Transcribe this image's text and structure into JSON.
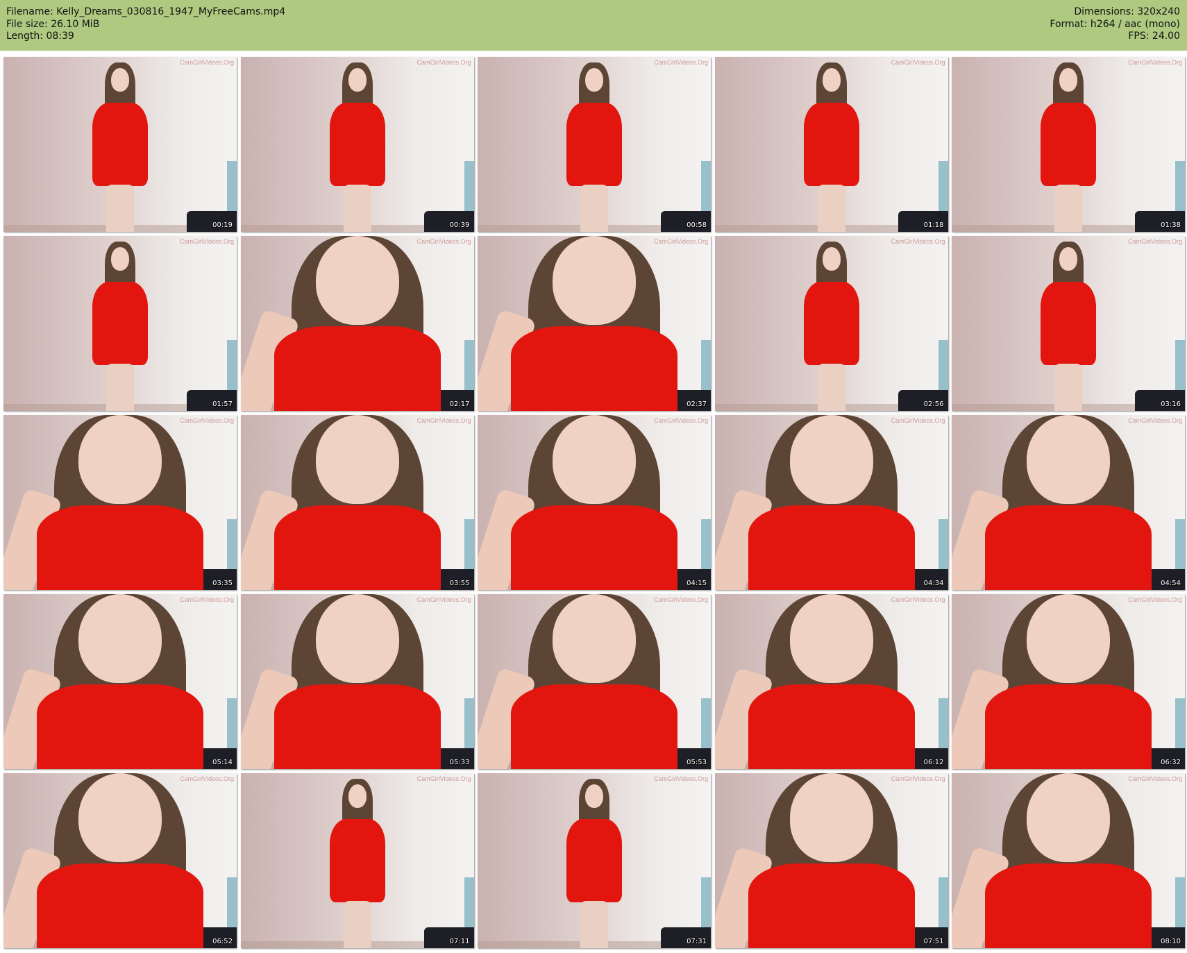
{
  "header": {
    "filename": "Filename: Kelly_Dreams_030816_1947_MyFreeCams.mp4",
    "filesize": "File size: 26.10 MiB",
    "length": "Length: 08:39",
    "dimensions": "Dimensions: 320x240",
    "format": "Format: h264 / aac (mono)",
    "fps": "FPS: 24.00"
  },
  "thumbnails": [
    {
      "time": "00:19",
      "watermark": "CamGirlVideos.Org",
      "shot": "full"
    },
    {
      "time": "00:39",
      "watermark": "CamGirlVideos.Org",
      "shot": "full"
    },
    {
      "time": "00:58",
      "watermark": "CamGirlVideos.Org",
      "shot": "full"
    },
    {
      "time": "01:18",
      "watermark": "CamGirlVideos.Org",
      "shot": "full"
    },
    {
      "time": "01:38",
      "watermark": "CamGirlVideos.Org",
      "shot": "full"
    },
    {
      "time": "01:57",
      "watermark": "CamGirlVideos.Org",
      "shot": "full"
    },
    {
      "time": "02:17",
      "watermark": "CamGirlVideos.Org",
      "shot": "close"
    },
    {
      "time": "02:37",
      "watermark": "CamGirlVideos.Org",
      "shot": "close"
    },
    {
      "time": "02:56",
      "watermark": "CamGirlVideos.Org",
      "shot": "full"
    },
    {
      "time": "03:16",
      "watermark": "CamGirlVideos.Org",
      "shot": "full"
    },
    {
      "time": "03:35",
      "watermark": "CamGirlVideos.Org",
      "shot": "close"
    },
    {
      "time": "03:55",
      "watermark": "CamGirlVideos.Org",
      "shot": "close"
    },
    {
      "time": "04:15",
      "watermark": "CamGirlVideos.Org",
      "shot": "close"
    },
    {
      "time": "04:34",
      "watermark": "CamGirlVideos.Org",
      "shot": "close"
    },
    {
      "time": "04:54",
      "watermark": "CamGirlVideos.Org",
      "shot": "close"
    },
    {
      "time": "05:14",
      "watermark": "CamGirlVideos.Org",
      "shot": "close"
    },
    {
      "time": "05:33",
      "watermark": "CamGirlVideos.Org",
      "shot": "close"
    },
    {
      "time": "05:53",
      "watermark": "CamGirlVideos.Org",
      "shot": "close"
    },
    {
      "time": "06:12",
      "watermark": "CamGirlVideos.Org",
      "shot": "close"
    },
    {
      "time": "06:32",
      "watermark": "CamGirlVideos.Org",
      "shot": "close"
    },
    {
      "time": "06:52",
      "watermark": "CamGirlVideos.Org",
      "shot": "close"
    },
    {
      "time": "07:11",
      "watermark": "CamGirlVideos.Org",
      "shot": "full"
    },
    {
      "time": "07:31",
      "watermark": "CamGirlVideos.Org",
      "shot": "full"
    },
    {
      "time": "07:51",
      "watermark": "CamGirlVideos.Org",
      "shot": "close"
    },
    {
      "time": "08:10",
      "watermark": "CamGirlVideos.Org",
      "shot": "close"
    }
  ],
  "colors": {
    "header_bg": "#afc981",
    "dress": "#e3160f",
    "wall": "#dcccca"
  }
}
